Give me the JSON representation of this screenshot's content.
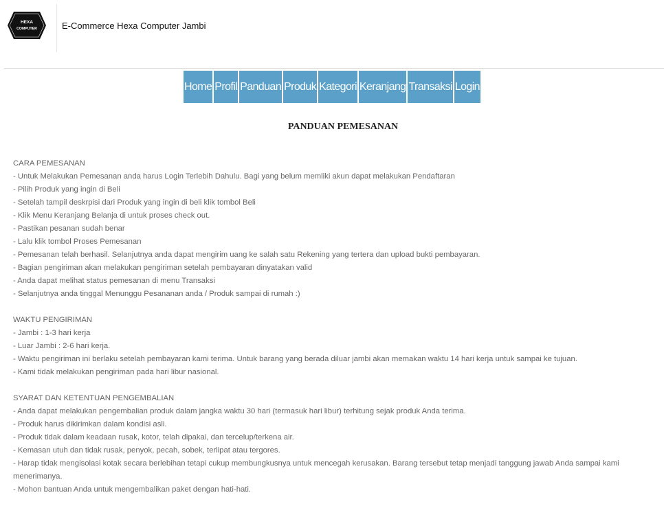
{
  "header": {
    "logo_text_line1": "HEXA",
    "logo_text_line2": "COMPUTER",
    "site_title": "E-Commerce Hexa Computer Jambi"
  },
  "nav": {
    "items": [
      "Home",
      "Profil",
      "Panduan",
      "Produk",
      "Kategori",
      "Keranjang",
      "Transaksi",
      "Login"
    ]
  },
  "page": {
    "heading": "PANDUAN PEMESANAN"
  },
  "sections": [
    {
      "title": "CARA PEMESANAN",
      "items": [
        "- Untuk Melakukan Pemesanan anda harus Login Terlebih Dahulu. Bagi yang belum memliki akun dapat melakukan Pendaftaran",
        "- Pilih Produk yang ingin di Beli",
        "- Setelah tampil deskrpisi dari Produk yang ingin di beli klik tombol Beli",
        "- Klik Menu Keranjang Belanja di untuk proses check out.",
        "- Pastikan pesanan sudah benar",
        "- Lalu klik tombol Proses Pemesanan",
        "- Pemesanan telah berhasil. Selanjutnya anda dapat mengirim uang ke salah satu Rekening yang tertera dan upload bukti pembayaran.",
        "- Bagian pengiriman akan melakukan pengiriman setelah pembayaran dinyatakan valid",
        "- Anda dapat melihat status pemesanan di menu Transaksi",
        "- Selanjutnya anda tinggal Menunggu Pesananan anda / Produk sampai di rumah :)"
      ]
    },
    {
      "title": "WAKTU PENGIRIMAN",
      "items": [
        "- Jambi : 1-3 hari kerja",
        "- Luar Jambi : 2-6 hari kerja.",
        "- Waktu pengiriman ini berlaku setelah pembayaran kami terima. Untuk barang yang berada diluar jambi akan memakan waktu 14 hari kerja untuk sampai ke tujuan.",
        "- Kami tidak melakukan pengiriman pada hari libur nasional."
      ]
    },
    {
      "title": "SYARAT DAN KETENTUAN PENGEMBALIAN",
      "items": [
        "- Anda dapat melakukan pengembalian produk dalam jangka waktu 30 hari (termasuk hari libur) terhitung sejak produk Anda terima.",
        "- Produk harus dikirimkan dalam kondisi asli.",
        "- Produk tidak dalam keadaan rusak, kotor, telah dipakai, dan tercelup/terkena air.",
        "- Kemasan utuh dan tidak rusak, penyok, pecah, sobek, terlipat atau tergores.",
        "- Harap tidak mengisolasi kotak secara berlebihan tetapi cukup membungkusnya untuk mencegah kerusakan. Barang tersebut tetap menjadi tanggung jawab Anda sampai kami menerimanya.",
        "- Mohon bantuan Anda untuk mengembalikan paket dengan hati-hati."
      ]
    }
  ],
  "colors": {
    "nav_background": "#5aa0c8",
    "nav_text": "#ffffff",
    "body_text": "#666666",
    "logo_fill": "#111111"
  }
}
